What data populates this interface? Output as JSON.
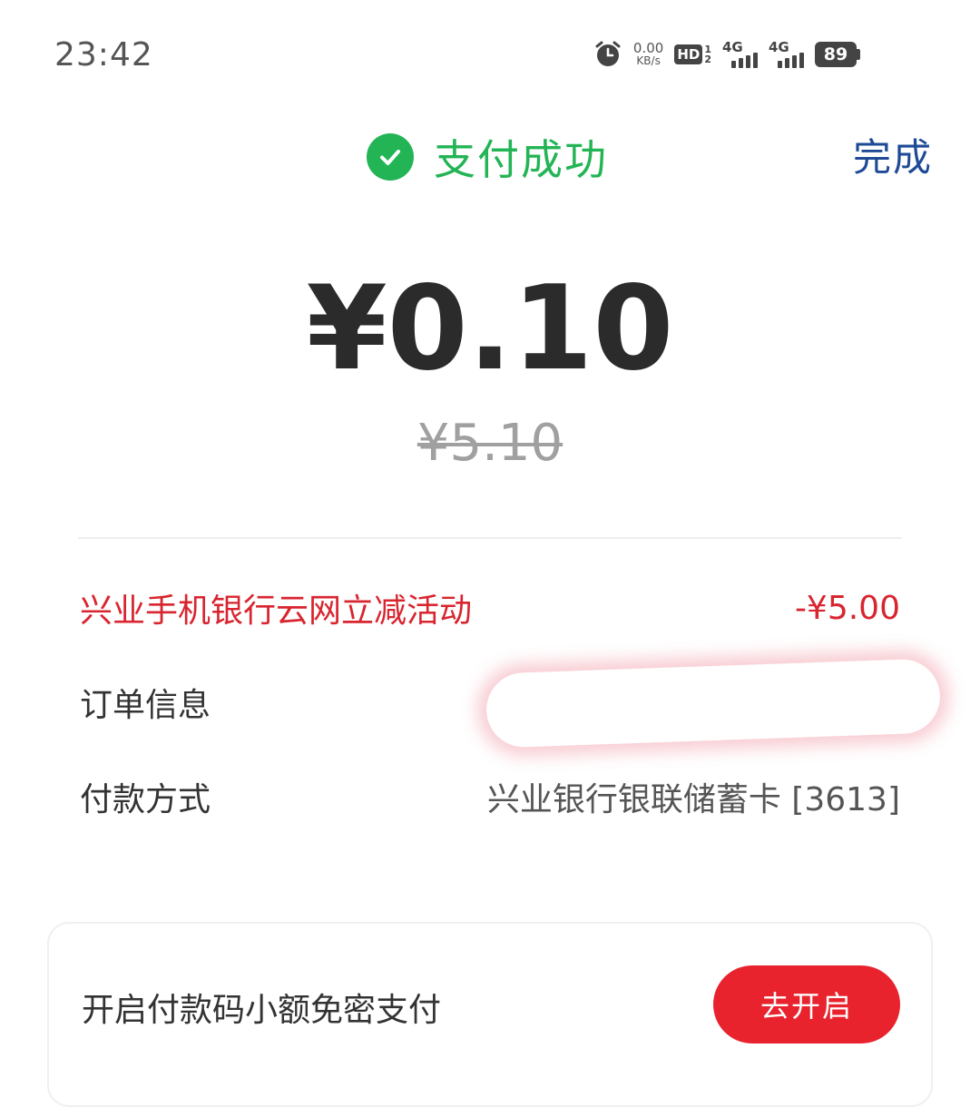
{
  "status_bar": {
    "time": "23:42",
    "net_speed_value": "0.00",
    "net_speed_unit": "KB/s",
    "hd_label": "HD",
    "hd_sim_top": "1",
    "hd_sim_bottom": "2",
    "signal1_type": "4G",
    "signal2_type": "4G",
    "battery": "89"
  },
  "header": {
    "title": "支付成功",
    "done_label": "完成",
    "success_color": "#22b455",
    "link_color": "#1e4a96"
  },
  "amounts": {
    "paid": "¥0.10",
    "original": "¥5.10"
  },
  "details": {
    "discount_label": "兴业手机银行云网立减活动",
    "discount_value": "-¥5.00",
    "order_label": "订单信息",
    "payment_label": "付款方式",
    "payment_value": "兴业银行银联储蓄卡 [3613]"
  },
  "promo": {
    "text": "开启付款码小额免密支付",
    "button_label": "去开启",
    "button_color": "#e8232e"
  }
}
